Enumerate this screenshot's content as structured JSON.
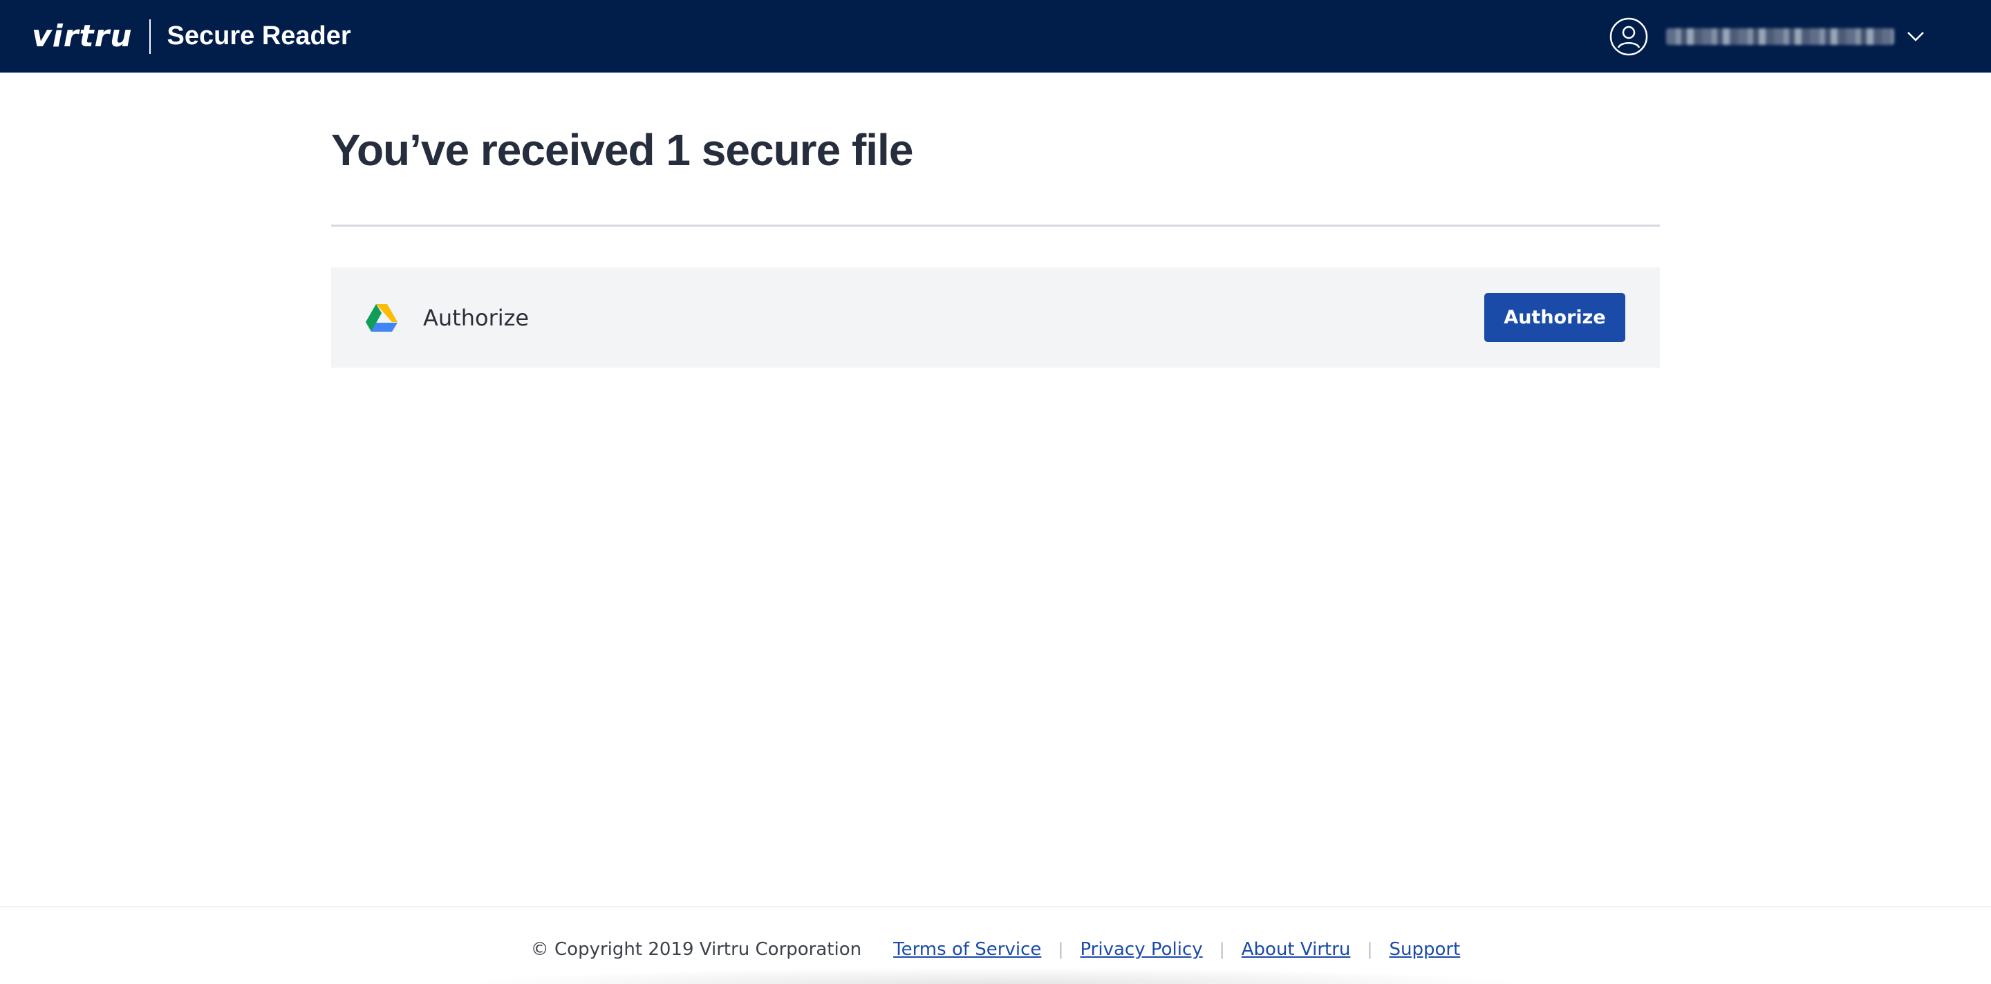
{
  "header": {
    "logo_text": "virtru",
    "app_name": "Secure Reader",
    "account": {
      "icon": "user-circle-icon",
      "name_redacted": "",
      "dropdown_icon": "chevron-down-icon"
    }
  },
  "main": {
    "heading": "You’ve received 1 secure file",
    "files": [
      {
        "icon": "google-drive-icon",
        "label": "Authorize",
        "button_label": "Authorize"
      }
    ]
  },
  "footer": {
    "copyright": "© Copyright 2019 Virtru Corporation",
    "links": [
      "Terms of Service",
      "Privacy Policy",
      "About Virtru",
      "Support"
    ],
    "separator": "|"
  },
  "colors": {
    "header_bg": "#011e4b",
    "primary_button": "#1a4ba8",
    "row_bg": "#f3f4f6",
    "heading_text": "#262d3d"
  }
}
